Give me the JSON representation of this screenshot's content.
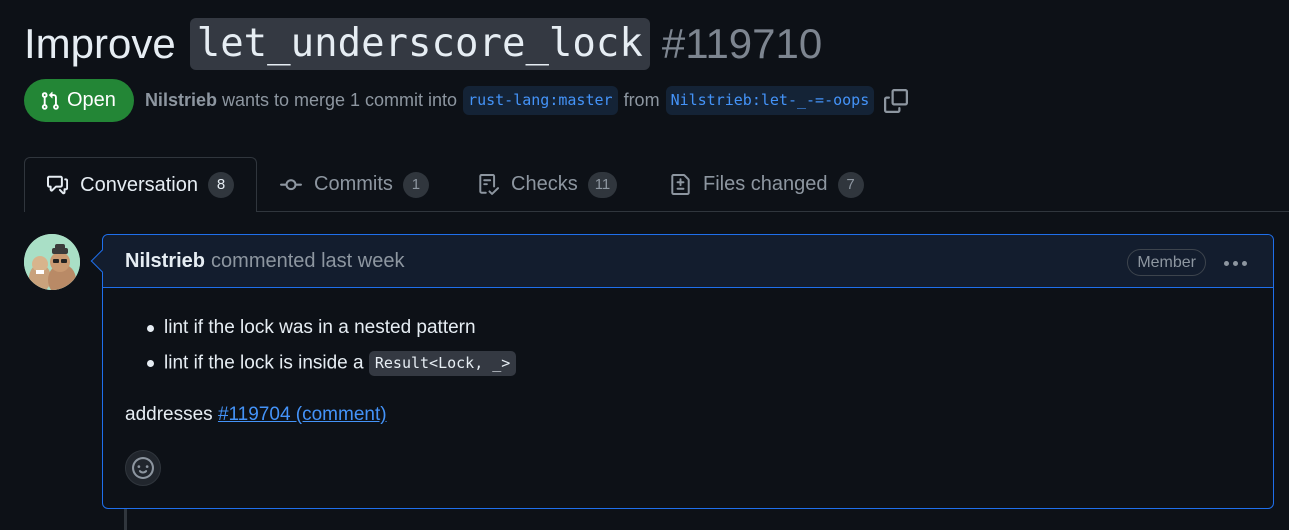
{
  "pr": {
    "title_prefix": "Improve",
    "title_code": "let_underscore_lock",
    "number": "#119710",
    "state": "Open",
    "author": "Nilstrieb",
    "merge_text": "wants to merge 1 commit into",
    "base_branch": "rust-lang:master",
    "from_text": "from",
    "head_branch": "Nilstrieb:let-_-=-oops"
  },
  "tabs": [
    {
      "label": "Conversation",
      "count": "8",
      "icon": "comment-discussion-icon"
    },
    {
      "label": "Commits",
      "count": "1",
      "icon": "git-commit-icon"
    },
    {
      "label": "Checks",
      "count": "11",
      "icon": "checklist-icon"
    },
    {
      "label": "Files changed",
      "count": "7",
      "icon": "file-diff-icon"
    }
  ],
  "comment": {
    "author": "Nilstrieb",
    "time": "commented last week",
    "role": "Member",
    "bullets": [
      {
        "text": "lint if the lock was in a nested pattern"
      },
      {
        "text": "lint if the lock is inside a",
        "code": "Result<Lock, _>"
      }
    ],
    "addresses_text": "addresses",
    "addresses_link": "#119704 (comment)"
  },
  "colors": {
    "background": "#0d1117",
    "open_badge": "#238636",
    "link": "#4493f8",
    "comment_border": "#1f6feb"
  }
}
